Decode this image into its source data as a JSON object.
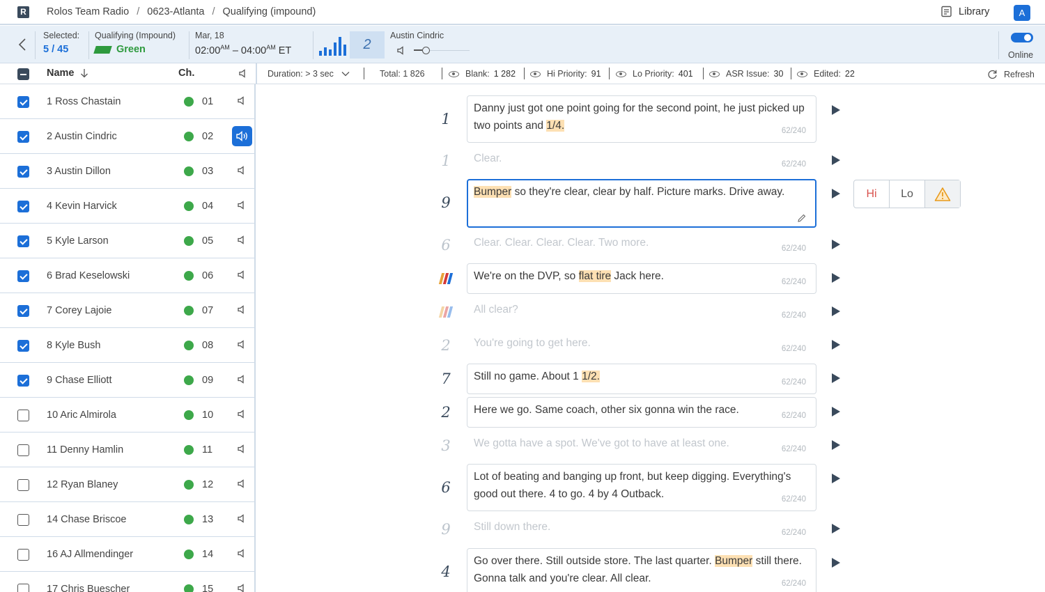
{
  "topbar": {
    "logo": "R",
    "breadcrumb": [
      "Rolos Team Radio",
      "0623-Atlanta",
      "Qualifying (impound)"
    ],
    "library_label": "Library",
    "avatar": "A"
  },
  "selection": {
    "selected_label": "Selected:",
    "selected_value": "5 / 45",
    "session_label": "Qualifying (Impound)",
    "flag_label": "Green",
    "date_label": "Mar, 18",
    "time_start": "02:00",
    "time_start_ampm": "AM",
    "time_end": "04:00",
    "time_end_ampm": "AM",
    "timezone": "ET",
    "count_box": "2",
    "driver_label": "Austin Cindric",
    "online_label": "Online"
  },
  "filters": {
    "name_header": "Name",
    "ch_header": "Ch.",
    "duration": "Duration: > 3 sec",
    "total": "Total: 1 826",
    "blank_label": "Blank:",
    "blank_value": "1 282",
    "hi_label": "Hi Priority:",
    "hi_value": "91",
    "lo_label": "Lo Priority:",
    "lo_value": "401",
    "asr_label": "ASR Issue:",
    "asr_value": "30",
    "edited_label": "Edited:",
    "edited_value": "22",
    "refresh_label": "Refresh"
  },
  "drivers": [
    {
      "name": "1 Ross Chastain",
      "ch": "01",
      "checked": true
    },
    {
      "name": "2 Austin Cindric",
      "ch": "02",
      "checked": true,
      "active": true
    },
    {
      "name": "3 Austin Dillon",
      "ch": "03",
      "checked": true
    },
    {
      "name": "4 Kevin Harvick",
      "ch": "04",
      "checked": true
    },
    {
      "name": "5 Kyle Larson",
      "ch": "05",
      "checked": true
    },
    {
      "name": "6 Brad Keselowski",
      "ch": "06",
      "checked": true
    },
    {
      "name": "7 Corey Lajoie",
      "ch": "07",
      "checked": true
    },
    {
      "name": "8 Kyle Bush",
      "ch": "08",
      "checked": true
    },
    {
      "name": "9 Chase Elliott",
      "ch": "09",
      "checked": true
    },
    {
      "name": "10 Aric Almirola",
      "ch": "10",
      "checked": false
    },
    {
      "name": "11 Denny Hamlin",
      "ch": "11",
      "checked": false
    },
    {
      "name": "12 Ryan Blaney",
      "ch": "12",
      "checked": false
    },
    {
      "name": "14 Chase Briscoe",
      "ch": "13",
      "checked": false
    },
    {
      "name": "16 AJ Allmendinger",
      "ch": "14",
      "checked": false
    },
    {
      "name": "17 Chris Buescher",
      "ch": "15",
      "checked": false
    }
  ],
  "transcripts": [
    {
      "num": "1",
      "text": "Danny just got one point going for the second point, he just picked up two points and ",
      "hl": "1/4.",
      "count": "62/240"
    },
    {
      "num": "1",
      "text": "Clear.",
      "count": "62/240"
    },
    {
      "num": "9",
      "hl_pre": "Bumper",
      "text": " so they're clear, clear by half. Picture marks. Drive away.",
      "count": ""
    },
    {
      "num": "6",
      "text": "Clear. Clear. Clear. Clear. Two more.",
      "count": "62/240"
    },
    {
      "num": "",
      "text": "We're on the DVP, so ",
      "hl": "flat tire",
      "text_post": " Jack here.",
      "count": "62/240"
    },
    {
      "num": "",
      "text": "All clear?",
      "count": "62/240"
    },
    {
      "num": "2",
      "text": "You're going to get here.",
      "count": "62/240"
    },
    {
      "num": "7",
      "text": "Still no game. About 1 ",
      "hl": "1/2.",
      "count": "62/240"
    },
    {
      "num": "2",
      "text": "Here we go. Same coach, other six gonna win the race.",
      "count": "62/240"
    },
    {
      "num": "3",
      "text": "We gotta have a spot. We've got to have at least one.",
      "count": "62/240"
    },
    {
      "num": "6",
      "text": "Lot of beating and banging up front, but keep digging. Everything's good out there. 4 to go. 4 by 4 Outback.",
      "count": "62/240"
    },
    {
      "num": "9",
      "text": "Still down there.",
      "count": "62/240"
    },
    {
      "num": "4",
      "text": "Go over there. Still outside store. The last quarter. ",
      "hl": "Bumper",
      "text_post": " still there. Gonna talk and you're clear. All clear.",
      "count": "62/240"
    }
  ],
  "priority": {
    "hi": "Hi",
    "lo": "Lo"
  }
}
